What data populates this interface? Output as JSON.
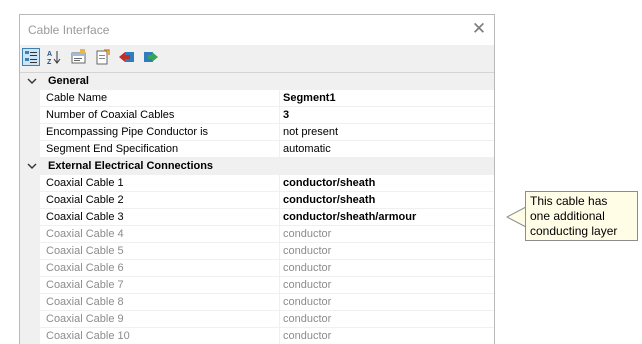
{
  "window": {
    "title": "Cable Interface"
  },
  "toolbar": {
    "buttons": [
      {
        "icon": "categorized-icon",
        "active": true
      },
      {
        "icon": "alphabetical-sort-icon"
      },
      {
        "icon": "property-pages-icon"
      },
      {
        "icon": "export-icon"
      },
      {
        "icon": "collapse-icon"
      },
      {
        "icon": "expand-icon"
      }
    ]
  },
  "grid": {
    "general": {
      "label": "General",
      "props": [
        {
          "name": "Cable Name",
          "value": "Segment1"
        },
        {
          "name": "Number of Coaxial Cables",
          "value": "3"
        },
        {
          "name": "Encompassing Pipe Conductor is",
          "value": "not present"
        },
        {
          "name": "Segment End Specification",
          "value": "automatic"
        }
      ]
    },
    "external": {
      "label": "External Electrical Connections",
      "props": [
        {
          "name": "Coaxial Cable 1",
          "value": "conductor/sheath"
        },
        {
          "name": "Coaxial Cable 2",
          "value": "conductor/sheath"
        },
        {
          "name": "Coaxial Cable 3",
          "value": "conductor/sheath/armour"
        },
        {
          "name": "Coaxial Cable 4",
          "value": "conductor"
        },
        {
          "name": "Coaxial Cable 5",
          "value": "conductor"
        },
        {
          "name": "Coaxial Cable 6",
          "value": "conductor"
        },
        {
          "name": "Coaxial Cable 7",
          "value": "conductor"
        },
        {
          "name": "Coaxial Cable 8",
          "value": "conductor"
        },
        {
          "name": "Coaxial Cable 9",
          "value": "conductor"
        },
        {
          "name": "Coaxial Cable 10",
          "value": "conductor"
        }
      ]
    }
  },
  "callout": {
    "line1": "This cable has",
    "line2": "one additional",
    "line3": "conducting layer"
  },
  "colors": {
    "accent": "#3c7fb1",
    "disabled_text": "#8c8c8c",
    "callout_bg": "#fffde6"
  }
}
